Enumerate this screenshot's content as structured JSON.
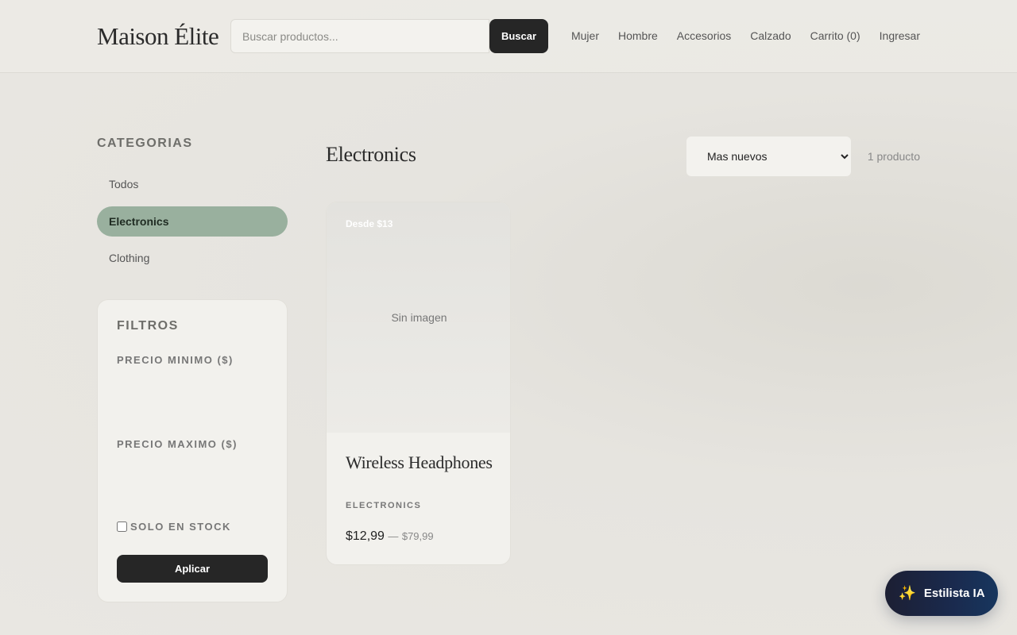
{
  "header": {
    "logo": "Maison Élite",
    "search_placeholder": "Buscar productos...",
    "search_button": "Buscar",
    "nav": [
      "Mujer",
      "Hombre",
      "Accesorios",
      "Calzado",
      "Carrito (0)",
      "Ingresar"
    ]
  },
  "sidebar": {
    "categories_title": "CATEGORIAS",
    "categories": [
      {
        "label": "Todos",
        "active": false
      },
      {
        "label": "Electronics",
        "active": true
      },
      {
        "label": "Clothing",
        "active": false
      }
    ],
    "filters": {
      "title": "FILTROS",
      "min_price_label": "PRECIO MINIMO ($)",
      "max_price_label": "PRECIO MAXIMO ($)",
      "in_stock_label": "SOLO EN STOCK",
      "in_stock_checked": false,
      "apply_button": "Aplicar"
    }
  },
  "main": {
    "title": "Electronics",
    "sort_selected": "Mas nuevos",
    "count": "1 producto",
    "products": [
      {
        "badge": "Desde $13",
        "image_placeholder": "Sin imagen",
        "name": "Wireless Headphones",
        "category": "ELECTRONICS",
        "price": "$12,99",
        "separator": "—",
        "price_high": "$79,99"
      }
    ]
  },
  "stylist_button": {
    "icon": "sparkle-icon",
    "label": "Estilista IA"
  },
  "colors": {
    "accent_active": "#99b09e",
    "button_dark": "#262626",
    "stylist_gradient_start": "#1c1f33",
    "stylist_gradient_end": "#17365e"
  }
}
